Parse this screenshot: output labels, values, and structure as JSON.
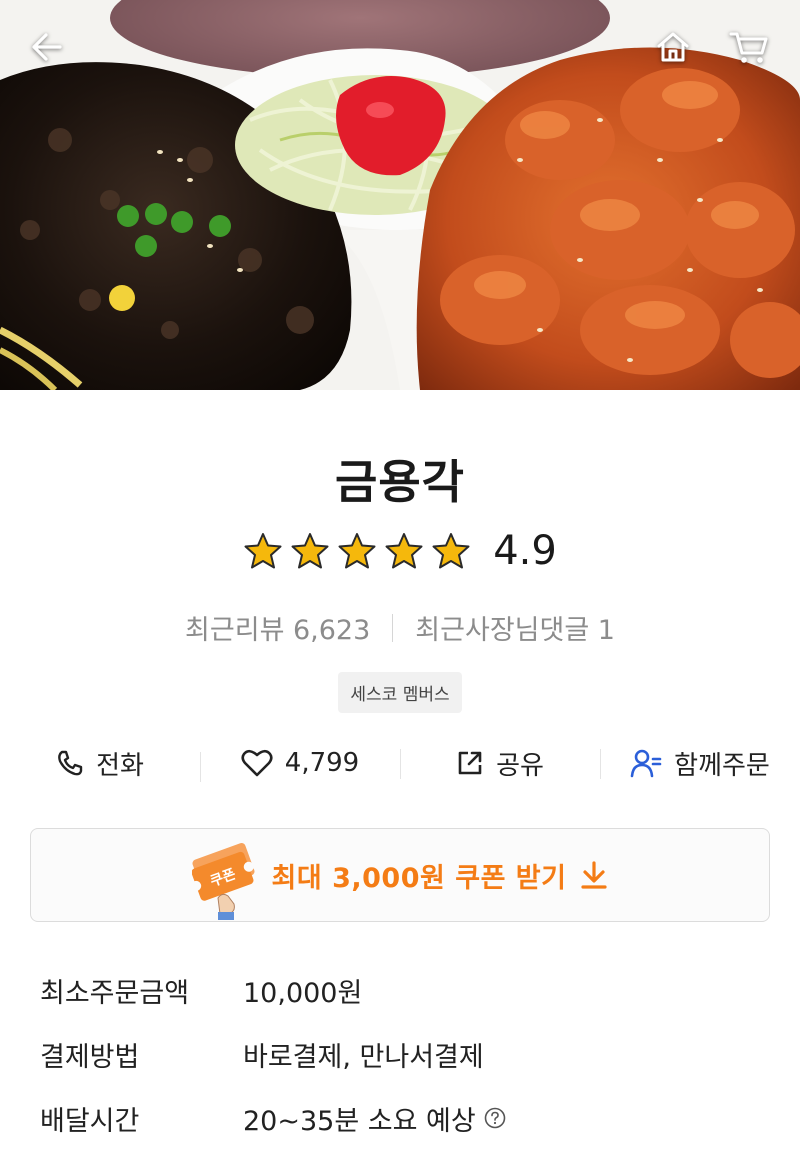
{
  "hero": {
    "back_icon": "arrow-left-icon",
    "home_icon": "home-icon",
    "cart_icon": "cart-icon"
  },
  "store": {
    "name": "금용각",
    "rating": "4.9",
    "rating_value": 4.9,
    "star_count": 5,
    "star_color": "#f5b80c",
    "recent_reviews": "최근리뷰 6,623",
    "owner_replies": "최근사장님댓글 1",
    "badge": "세스코 멤버스"
  },
  "actions": {
    "call": {
      "label": "전화",
      "icon": "phone-icon"
    },
    "like": {
      "label": "4,799",
      "icon": "heart-icon"
    },
    "share": {
      "label": "공유",
      "icon": "share-icon"
    },
    "group": {
      "label": "함께주문",
      "icon": "user-icon",
      "icon_color": "#2b5fd9"
    }
  },
  "coupon": {
    "text": "최대 3,000원 쿠폰 받기",
    "icon_label": "쿠폰",
    "accent_color": "#f47c15"
  },
  "info": [
    {
      "label": "최소주문금액",
      "value": "10,000원"
    },
    {
      "label": "결제방법",
      "value": "바로결제, 만나서결제"
    },
    {
      "label": "배달시간",
      "value": "20~35분 소요 예상"
    }
  ]
}
